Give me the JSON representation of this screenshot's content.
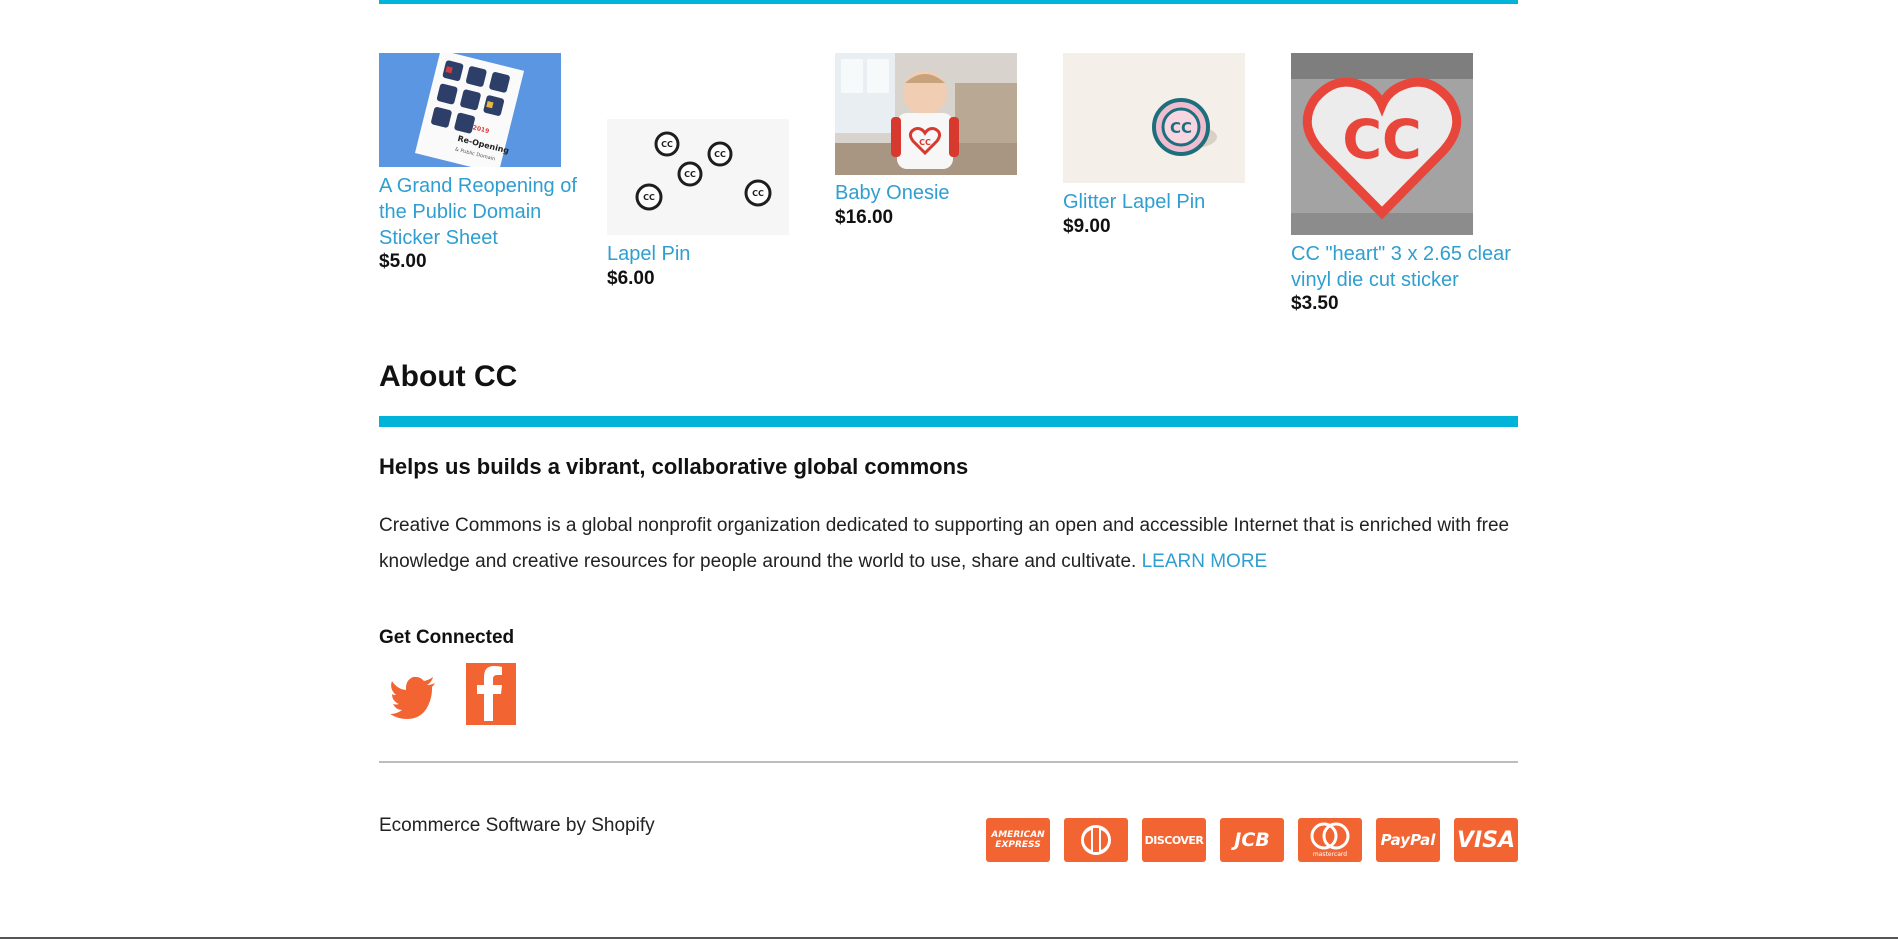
{
  "products": [
    {
      "title": "A Grand Reopening of the Public Domain Sticker Sheet",
      "price": "$5.00",
      "image": "sticker-sheet-image"
    },
    {
      "title": "Lapel Pin",
      "price": "$6.00",
      "image": "lapel-pins-image"
    },
    {
      "title": "Baby Onesie",
      "price": "$16.00",
      "image": "baby-onesie-image"
    },
    {
      "title": "Glitter Lapel Pin",
      "price": "$9.00",
      "image": "glitter-pin-image"
    },
    {
      "title": "CC \"heart\" 3 x 2.65 clear vinyl die cut sticker",
      "price": "$3.50",
      "image": "heart-sticker-image"
    }
  ],
  "sticker_sheet": {
    "headline_small": "2019",
    "headline": "Re-Opening",
    "subtitle": "& Public Domain"
  },
  "cc_text": "CC",
  "about": {
    "title": "About CC",
    "subtitle": "Helps us builds a vibrant, collaborative global commons",
    "body": "Creative Commons is a global nonprofit organization dedicated to supporting an open and accessible Internet that is enriched with free knowledge and creative resources for people around the world to use, share and cultivate.",
    "link": "LEARN MORE"
  },
  "connect": {
    "title": "Get Connected",
    "icons": [
      "twitter-icon",
      "facebook-icon"
    ]
  },
  "footer": {
    "credit": "Ecommerce Software by Shopify",
    "payments": [
      {
        "name": "american-express-icon",
        "label": "AMERICAN EXPRESS"
      },
      {
        "name": "diners-club-icon",
        "label": ""
      },
      {
        "name": "discover-icon",
        "label": "DISCOVER"
      },
      {
        "name": "jcb-icon",
        "label": "JCB"
      },
      {
        "name": "mastercard-icon",
        "label": "mastercard"
      },
      {
        "name": "paypal-icon",
        "label": "PayPal"
      },
      {
        "name": "visa-icon",
        "label": "VISA"
      }
    ]
  },
  "colors": {
    "accent": "#00b3d9",
    "link": "#2f9ed1",
    "social": "#f26532",
    "heart": "#e8463b"
  }
}
